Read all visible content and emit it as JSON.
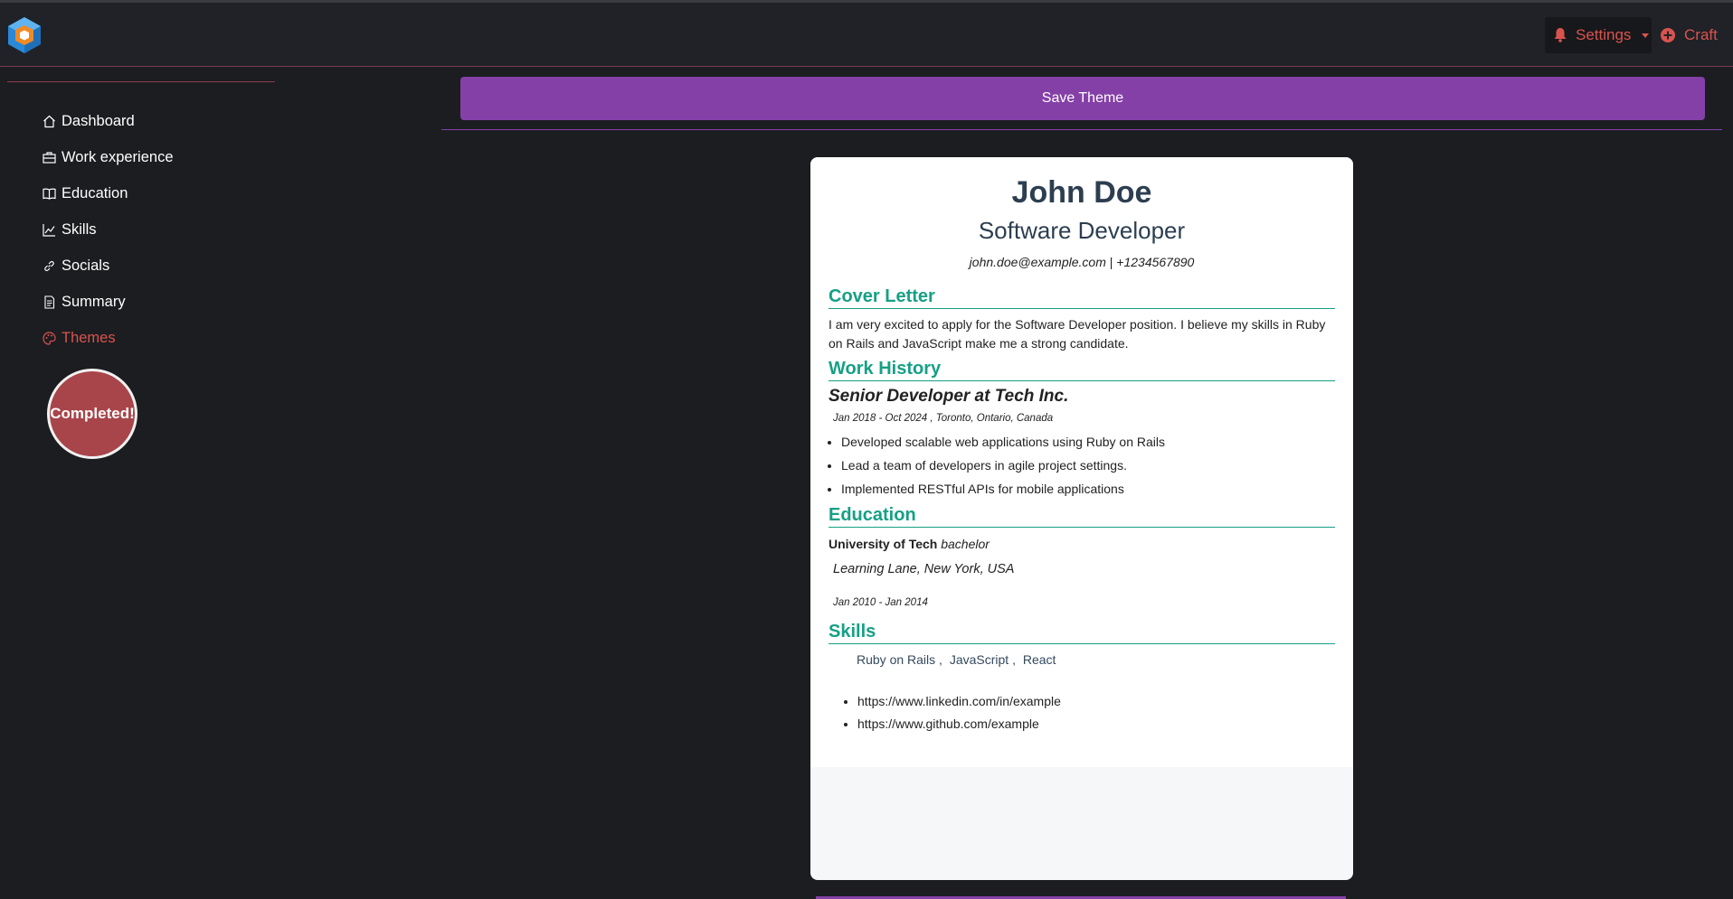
{
  "header": {
    "settings_label": "Settings",
    "craft_label": "Craft",
    "accent_color": "#d9534f"
  },
  "sidebar": {
    "items": [
      {
        "label": "Dashboard",
        "icon": "home-icon"
      },
      {
        "label": "Work experience",
        "icon": "briefcase-icon"
      },
      {
        "label": "Education",
        "icon": "book-icon"
      },
      {
        "label": "Skills",
        "icon": "chart-line-icon"
      },
      {
        "label": "Socials",
        "icon": "link-icon"
      },
      {
        "label": "Summary",
        "icon": "document-icon"
      },
      {
        "label": "Themes",
        "icon": "palette-icon",
        "active": true
      }
    ],
    "badge_text": "Completed!"
  },
  "main": {
    "save_button": "Save Theme",
    "button_color": "#8540a8"
  },
  "resume": {
    "name": "John Doe",
    "title": "Software Developer",
    "email": "john.doe@example.com",
    "separator": " | ",
    "phone": "+1234567890",
    "sections": {
      "cover_letter": "Cover Letter",
      "work_history": "Work History",
      "education": "Education",
      "skills": "Skills"
    },
    "cover_letter_text": "I am very excited to apply for the Software Developer position. I believe my skills in Ruby on Rails and JavaScript make me a strong candidate.",
    "job": {
      "title": "Senior Developer at Tech Inc.",
      "meta": "Jan 2018 - Oct 2024 , Toronto, Ontario, Canada",
      "bullets": [
        "Developed scalable web applications using Ruby on Rails",
        "Lead a team of developers in agile project settings.",
        "Implemented RESTful APIs for mobile applications"
      ]
    },
    "education": {
      "school": "University of Tech",
      "degree": "bachelor",
      "address": "Learning Lane, New York, USA",
      "dates": "Jan 2010 - Jan 2014"
    },
    "skills": [
      "Ruby on Rails ,",
      "JavaScript ,",
      "React"
    ],
    "links": [
      "https://www.linkedin.com/in/example",
      "https://www.github.com/example"
    ],
    "heading_color": "#16a085"
  }
}
